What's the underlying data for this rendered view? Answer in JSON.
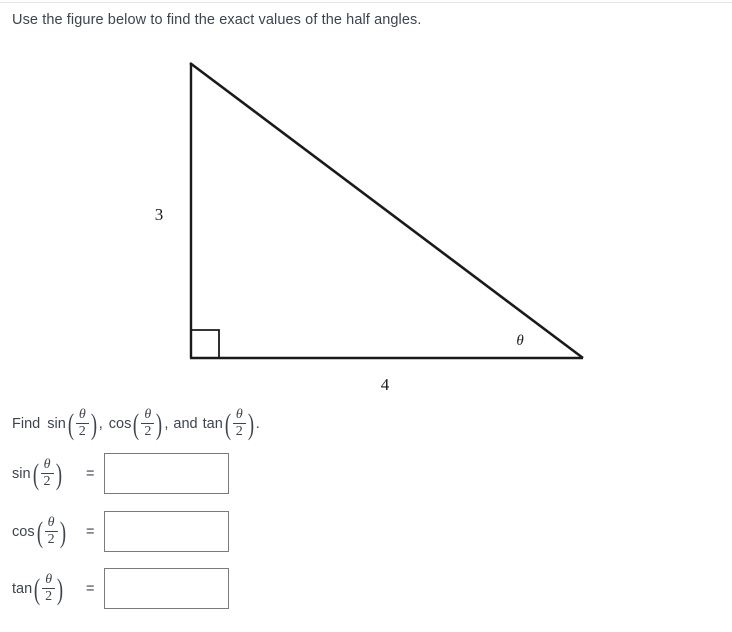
{
  "prompt": "Use the figure below to find the exact values of the half angles.",
  "figure": {
    "vertical_leg_label": "3",
    "horizontal_leg_label": "4",
    "angle_label": "θ",
    "right_angle_marker": "right-angle-square",
    "stroke_color": "#1a1a1a"
  },
  "instruction": {
    "lead": "Find",
    "items": [
      {
        "func": "sin",
        "numerator": "θ",
        "denominator": "2",
        "after": ","
      },
      {
        "func": "cos",
        "numerator": "θ",
        "denominator": "2",
        "after": ","
      },
      {
        "func": "tan",
        "numerator": "θ",
        "denominator": "2",
        "after": "."
      }
    ],
    "conjunction": "and",
    "open_paren": "(",
    "close_paren": ")"
  },
  "answers": [
    {
      "func": "sin",
      "numerator": "θ",
      "denominator": "2",
      "equals": "=",
      "value": "",
      "placeholder": ""
    },
    {
      "func": "cos",
      "numerator": "θ",
      "denominator": "2",
      "equals": "=",
      "value": "",
      "placeholder": ""
    },
    {
      "func": "tan",
      "numerator": "θ",
      "denominator": "2",
      "equals": "=",
      "value": "",
      "placeholder": ""
    }
  ],
  "colors": {
    "text": "#3d4450",
    "figure_stroke": "#1a1a1a",
    "box_border": "#7a7a7a",
    "divider": "#e3e5e8",
    "background": "#ffffff"
  }
}
